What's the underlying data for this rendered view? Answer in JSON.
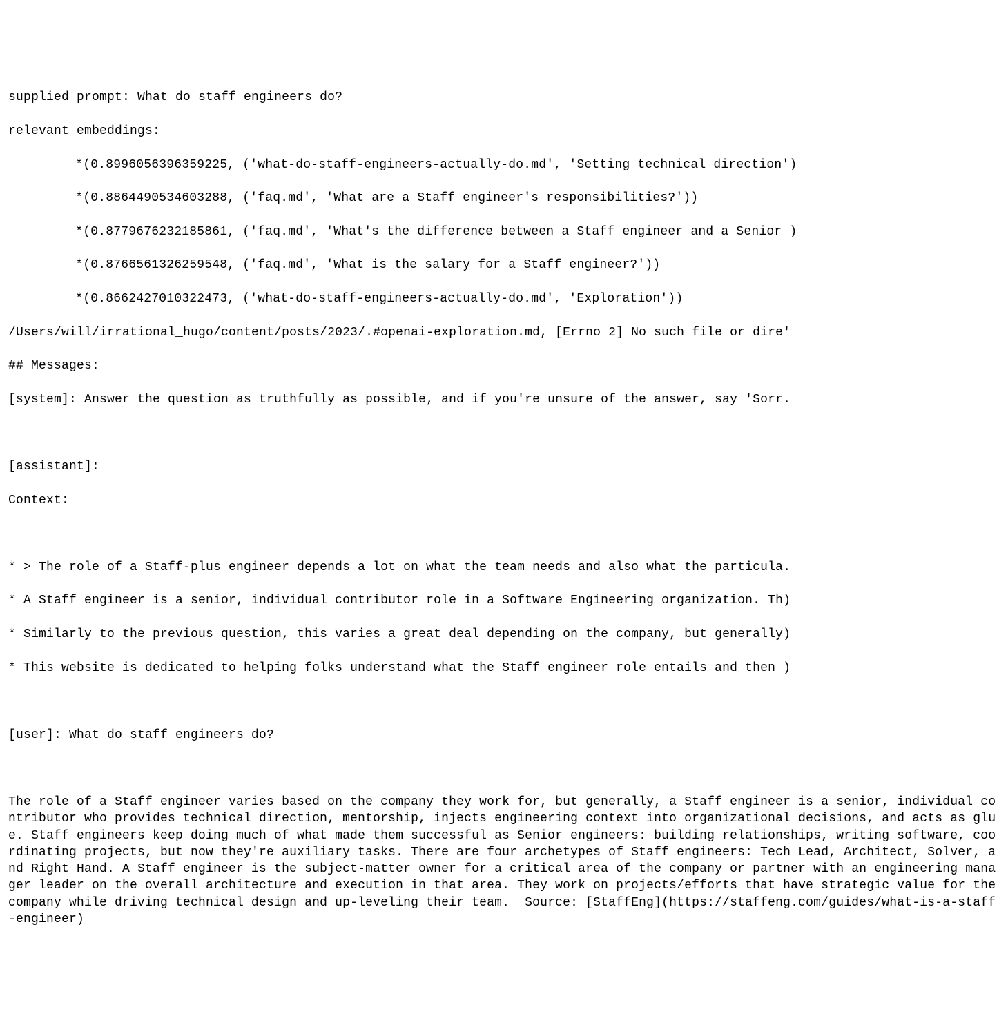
{
  "header": {
    "prompt_label": "supplied prompt: ",
    "prompt_text": "What do staff engineers do?",
    "embeddings_label": "relevant embeddings:"
  },
  "embeddings": [
    "*(0.8996056396359225, ('what-do-staff-engineers-actually-do.md', 'Setting technical direction')",
    "*(0.8864490534603288, ('faq.md', 'What are a Staff engineer's responsibilities?'))",
    "*(0.8779676232185861, ('faq.md', 'What's the difference between a Staff engineer and a Senior )",
    "*(0.8766561326259548, ('faq.md', 'What is the salary for a Staff engineer?'))",
    "*(0.8662427010322473, ('what-do-staff-engineers-actually-do.md', 'Exploration'))"
  ],
  "error_line": "/Users/will/irrational_hugo/content/posts/2023/.#openai-exploration.md, [Errno 2] No such file or dire'",
  "messages_header": "## Messages:",
  "system_line": "[system]: Answer the question as truthfully as possible, and if you're unsure of the answer, say 'Sorr.",
  "assistant_label": "[assistant]:",
  "context_label": "Context:",
  "context_bullets": [
    "* > The role of a Staff-plus engineer depends a lot on what the team needs and also what the particula.",
    "* A Staff engineer is a senior, individual contributor role in a Software Engineering organization. Th)",
    "* Similarly to the previous question, this varies a great deal depending on the company, but generally)",
    "* This website is dedicated to helping folks understand what the Staff engineer role entails and then )"
  ],
  "user_line": "[user]: What do staff engineers do?",
  "answer": "The role of a Staff engineer varies based on the company they work for, but generally, a Staff engineer is a senior, individual contributor who provides technical direction, mentorship, injects engineering context into organizational decisions, and acts as glue. Staff engineers keep doing much of what made them successful as Senior engineers: building relationships, writing software, coordinating projects, but now they're auxiliary tasks. There are four archetypes of Staff engineers: Tech Lead, Architect, Solver, and Right Hand. A Staff engineer is the subject-matter owner for a critical area of the company or partner with an engineering manager leader on the overall architecture and execution in that area. They work on projects/efforts that have strategic value for the company while driving technical design and up-leveling their team.  Source: [StaffEng](https://staffeng.com/guides/what-is-a-staff-engineer)"
}
